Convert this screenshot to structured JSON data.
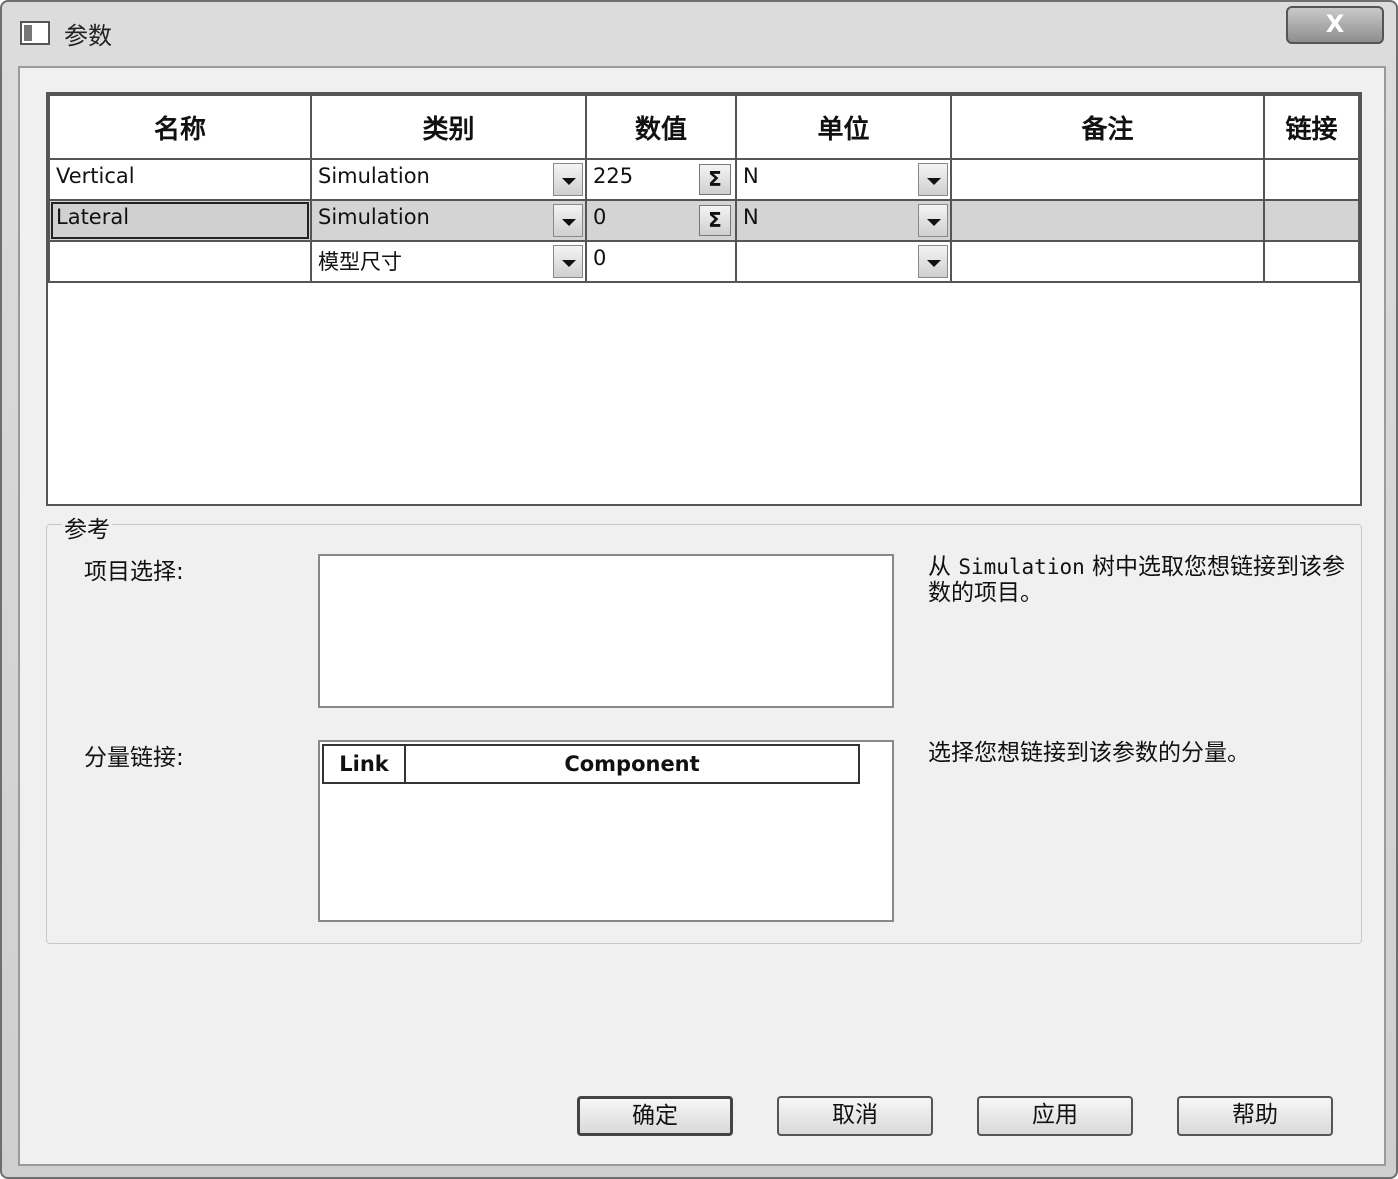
{
  "window": {
    "title": "参数",
    "close_label": "X"
  },
  "grid": {
    "columns": [
      "名称",
      "类别",
      "数值",
      "单位",
      "备注",
      "链接"
    ],
    "rows": [
      {
        "name": "Vertical",
        "category": "Simulation",
        "value": "225",
        "unit": "N",
        "note": "",
        "link": ""
      },
      {
        "name": "Lateral",
        "category": "Simulation",
        "value": "0",
        "unit": "N",
        "note": "",
        "link": ""
      },
      {
        "name": "",
        "category": "模型尺寸",
        "value": "0",
        "unit": "",
        "note": "",
        "link": ""
      }
    ],
    "selected_row": 1,
    "sigma_label": "Σ"
  },
  "reference": {
    "group_label": "参考",
    "item_select_label": "项目选择:",
    "item_hint_prefix": "从 ",
    "item_hint_mono": "Simulation",
    "item_hint_suffix": " 树中选取您想链接到该参数的项目。",
    "component_label": "分量链接:",
    "component_hint": "选择您想链接到该参数的分量。",
    "component_columns": [
      "Link",
      "Component"
    ]
  },
  "buttons": {
    "ok": "确定",
    "cancel": "取消",
    "apply": "应用",
    "help": "帮助"
  }
}
